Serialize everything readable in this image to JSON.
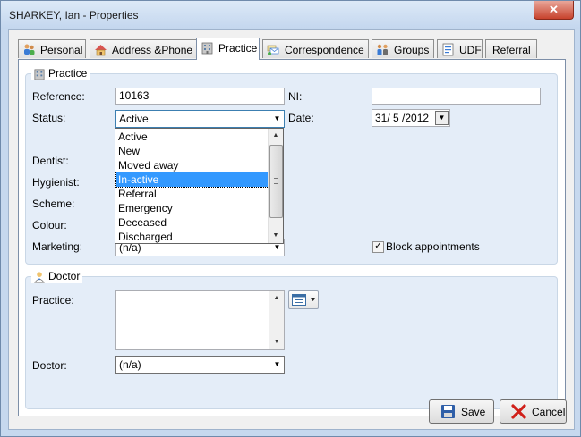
{
  "window": {
    "title": "SHARKEY, Ian - Properties",
    "close_glyph": "✕"
  },
  "tabs": [
    {
      "label": "Personal",
      "icon": "people-icon"
    },
    {
      "label": "Address &Phone",
      "icon": "house-icon"
    },
    {
      "label": "Practice",
      "icon": "building-icon",
      "active": true
    },
    {
      "label": "Correspondence",
      "icon": "letters-icon"
    },
    {
      "label": "Groups",
      "icon": "group-icon"
    },
    {
      "label": "UDF",
      "icon": "form-icon"
    },
    {
      "label": "Referral",
      "icon": ""
    }
  ],
  "practice_group": {
    "legend": "Practice",
    "reference_label": "Reference:",
    "reference_value": "10163",
    "ni_label": "NI:",
    "ni_value": "",
    "status_label": "Status:",
    "status_value": "Active",
    "date_label": "Date:",
    "date_value": "31/ 5 /2012",
    "dentist_label": "Dentist:",
    "hygienist_label": "Hygienist:",
    "scheme_label": "Scheme:",
    "colour_label": "Colour:",
    "marketing_label": "Marketing:",
    "marketing_value": "(n/a)",
    "block_label": "Block appointments",
    "block_checked": true
  },
  "status_dropdown": {
    "options": [
      "Active",
      "New",
      "Moved away",
      "In-active",
      "Referral",
      "Emergency",
      "Deceased",
      "Discharged"
    ],
    "highlighted_index": 3
  },
  "doctor_group": {
    "legend": "Doctor",
    "practice_label": "Practice:",
    "practice_value": "",
    "doctor_label": "Doctor:",
    "doctor_value": "(n/a)"
  },
  "buttons": {
    "save_label": "Save",
    "cancel_label": "Cancel"
  },
  "colors": {
    "accent": "#3399ff",
    "title_bar": "#c3d6ee",
    "group_bg": "#e4edf8",
    "close": "#c7432d"
  }
}
